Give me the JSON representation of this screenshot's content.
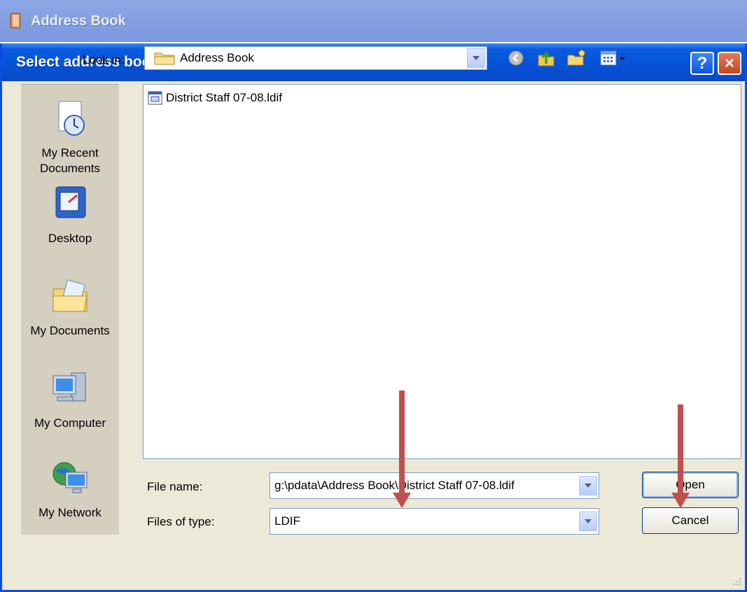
{
  "parent_window": {
    "title": "Address Book"
  },
  "dialog": {
    "title": "Select address book file",
    "help_glyph": "?",
    "close_glyph": "×"
  },
  "look_in": {
    "label": "Look in:",
    "value": "Address Book"
  },
  "places": [
    {
      "label_line1": "My Recent",
      "label_line2": "Documents",
      "icon": "recent-documents-icon"
    },
    {
      "label_line1": "Desktop",
      "label_line2": "",
      "icon": "desktop-icon"
    },
    {
      "label_line1": "My Documents",
      "label_line2": "",
      "icon": "my-documents-icon"
    },
    {
      "label_line1": "My Computer",
      "label_line2": "",
      "icon": "my-computer-icon"
    },
    {
      "label_line1": "My Network",
      "label_line2": "",
      "icon": "my-network-icon"
    }
  ],
  "files": [
    {
      "name": "District Staff 07-08.ldif",
      "icon": "ldif-file-icon"
    }
  ],
  "file_name": {
    "label": "File name:",
    "value": "g:\\pdata\\Address Book\\District Staff 07-08.ldif"
  },
  "file_type": {
    "label": "Files of type:",
    "value": "LDIF"
  },
  "buttons": {
    "open": "Open",
    "cancel": "Cancel"
  },
  "colors": {
    "xp_blue": "#0452d6",
    "dialog_bg": "#ece9d8",
    "annotation_red": "#c0504d"
  }
}
